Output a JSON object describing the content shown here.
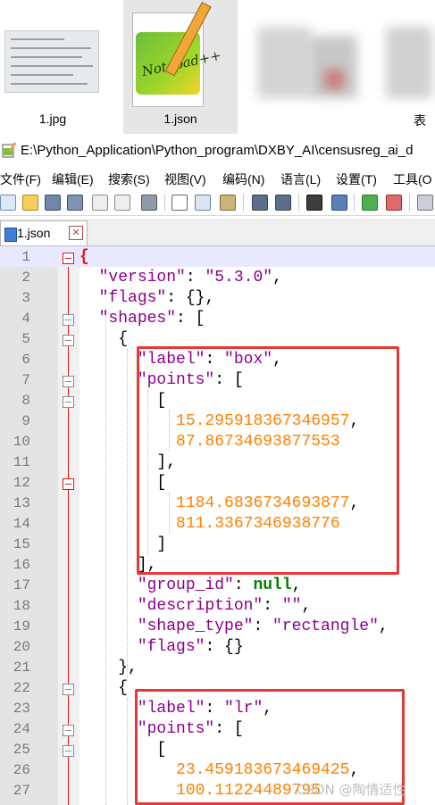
{
  "thumbnails": [
    {
      "name": "1.jpg"
    },
    {
      "name": "1.json"
    },
    {
      "name": ""
    },
    {
      "name": "表"
    }
  ],
  "window": {
    "title": "E:\\Python_Application\\Python_program\\DXBY_AI\\censusreg_ai_d"
  },
  "menu": [
    "文件(F)",
    "编辑(E)",
    "搜索(S)",
    "视图(V)",
    "编码(N)",
    "语言(L)",
    "设置(T)",
    "工具(O"
  ],
  "tab": {
    "name": "1.json"
  },
  "editor": {
    "lines": [
      {
        "n": "1"
      },
      {
        "n": "2"
      },
      {
        "n": "3"
      },
      {
        "n": "4"
      },
      {
        "n": "5"
      },
      {
        "n": "6"
      },
      {
        "n": "7"
      },
      {
        "n": "8"
      },
      {
        "n": "9"
      },
      {
        "n": "10"
      },
      {
        "n": "11"
      },
      {
        "n": "12"
      },
      {
        "n": "13"
      },
      {
        "n": "14"
      },
      {
        "n": "15"
      },
      {
        "n": "16"
      },
      {
        "n": "17"
      },
      {
        "n": "18"
      },
      {
        "n": "19"
      },
      {
        "n": "20"
      },
      {
        "n": "21"
      },
      {
        "n": "22"
      },
      {
        "n": "23"
      },
      {
        "n": "24"
      },
      {
        "n": "25"
      },
      {
        "n": "26"
      },
      {
        "n": "27"
      }
    ],
    "tokens": {
      "version_key": "\"version\"",
      "version_val": "\"5.3.0\"",
      "flags_key": "\"flags\"",
      "shapes_key": "\"shapes\"",
      "label_key": "\"label\"",
      "label_box": "\"box\"",
      "label_lr": "\"lr\"",
      "points_key": "\"points\"",
      "p1x": "15.295918367346957",
      "p1y": "87.86734693877553",
      "p2x": "1184.6836734693877",
      "p2y": "811.3367346938776",
      "p3x": "23.459183673469425",
      "p3y": "100.11224489795",
      "group_key": "\"group_id\"",
      "null_val": "null",
      "desc_key": "\"description\"",
      "desc_val": "\"\"",
      "stype_key": "\"shape_type\"",
      "stype_val": "\"rectangle\""
    }
  },
  "watermark": "CSDN @陶情适性",
  "colors": {
    "highlight": "#e53935",
    "string": "#8b008b",
    "number": "#ff8000",
    "keyword": "#008000"
  }
}
